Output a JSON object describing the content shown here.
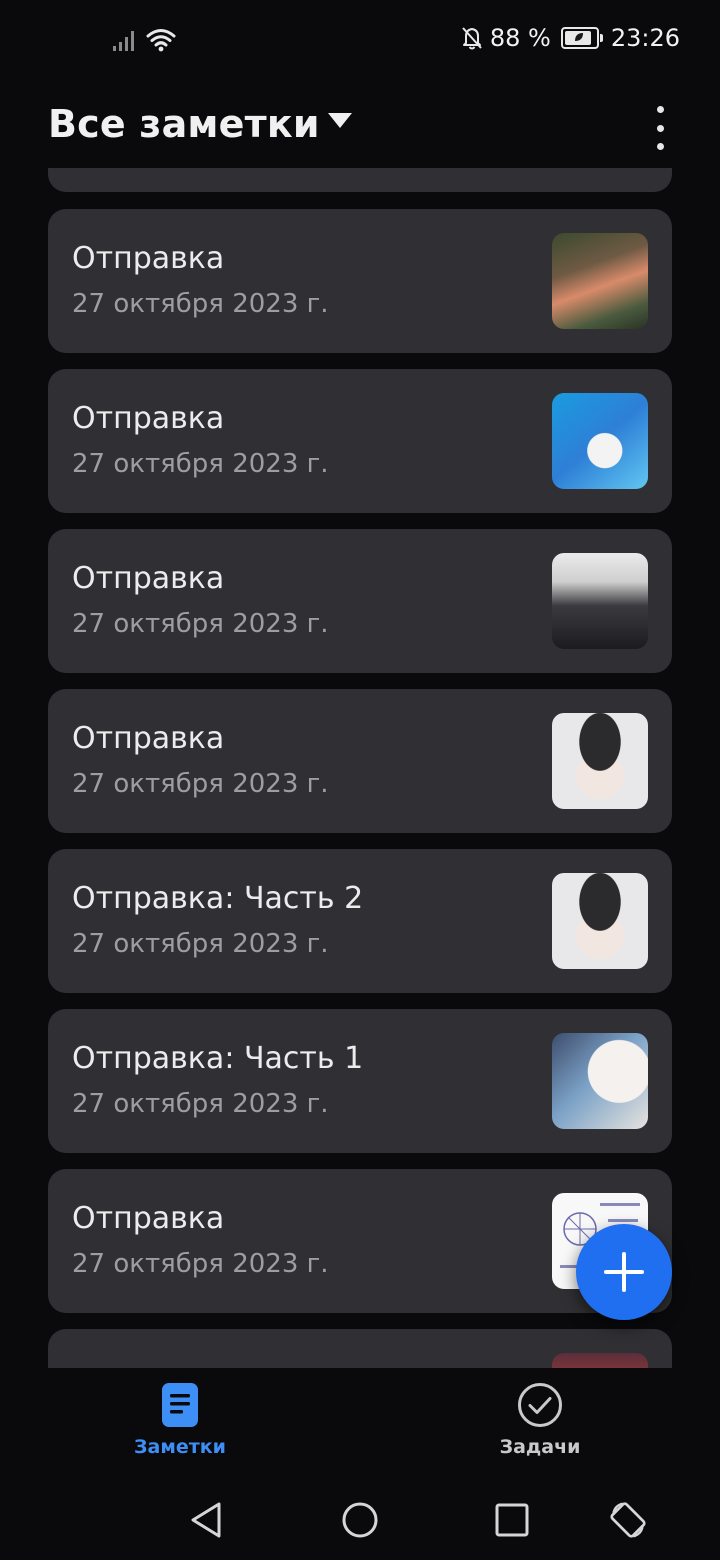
{
  "status_bar": {
    "battery_percent": "88 %",
    "time": "23:26",
    "battery_level": 0.88,
    "icons": [
      "signal-icon",
      "wifi-icon",
      "bell-off-icon",
      "battery-icon"
    ]
  },
  "header": {
    "title": "Все заметки",
    "dropdown_icon": "caret-down-icon",
    "menu_icon": "more-vertical-icon"
  },
  "notes": [
    {
      "title": "Отправка",
      "date": "27 октября 2023 г.",
      "thumbnail": "photo"
    },
    {
      "title": "Отправка",
      "date": "27 октября 2023 г.",
      "thumbnail": "photo"
    },
    {
      "title": "Отправка",
      "date": "27 октября 2023 г.",
      "thumbnail": "photo"
    },
    {
      "title": "Отправка",
      "date": "27 октября 2023 г.",
      "thumbnail": "photo"
    },
    {
      "title": "Отправка: Часть 2",
      "date": "27 октября 2023 г.",
      "thumbnail": "photo"
    },
    {
      "title": "Отправка: Часть 1",
      "date": "27 октября 2023 г.",
      "thumbnail": "photo"
    },
    {
      "title": "Отправка",
      "date": "27 октября 2023 г.",
      "thumbnail": "document"
    }
  ],
  "fab": {
    "icon": "plus-icon"
  },
  "bottom_nav": {
    "notes_label": "Заметки",
    "tasks_label": "Задачи",
    "active_tab": "notes"
  },
  "colors": {
    "background": "#0a0a0c",
    "card": "#302f33",
    "accent": "#1f6ff0",
    "active_tab": "#3d8ef5",
    "secondary_text": "#9e9da2"
  }
}
